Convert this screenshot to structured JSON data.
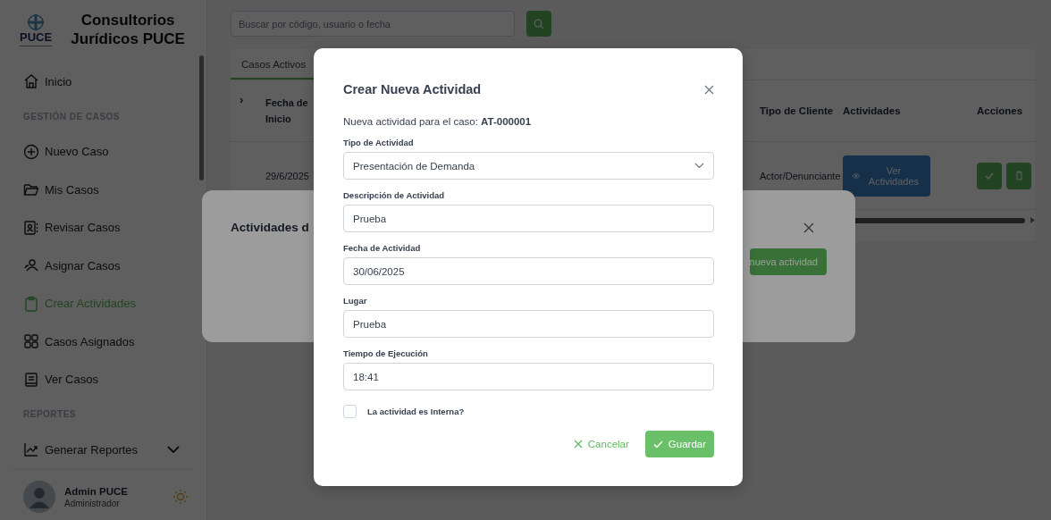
{
  "sidebar": {
    "brand": {
      "logo_text": "PUCE",
      "title": "Consultorios Jurídicos PUCE"
    },
    "items": [
      {
        "kind": "link",
        "label": "Inicio",
        "selected": false
      },
      {
        "kind": "section",
        "label": "GESTIÓN DE CASOS"
      },
      {
        "kind": "link",
        "label": "Nuevo Caso",
        "selected": false
      },
      {
        "kind": "link",
        "label": "Mis Casos",
        "selected": false
      },
      {
        "kind": "link",
        "label": "Revisar Casos",
        "selected": false
      },
      {
        "kind": "link",
        "label": "Asignar Casos",
        "selected": false
      },
      {
        "kind": "link",
        "label": "Crear Actividades",
        "selected": true
      },
      {
        "kind": "link",
        "label": "Casos Asignados",
        "selected": false
      },
      {
        "kind": "link",
        "label": "Ver Casos",
        "selected": false
      },
      {
        "kind": "section",
        "label": "REPORTES"
      },
      {
        "kind": "dropdown",
        "label": "Generar Reportes",
        "selected": false
      }
    ],
    "user": {
      "name": "Admin PUCE",
      "role": "Administrador"
    }
  },
  "main": {
    "search": {
      "placeholder": "Buscar por código, usuario o fecha"
    },
    "tabs": [
      {
        "label": "Casos Activos",
        "selected": true
      }
    ],
    "table": {
      "expand_caret": "›",
      "columns": [
        {
          "label": "Fecha de Inicio"
        },
        {
          "label": "Tipo de Cliente"
        },
        {
          "label": "Actividades"
        },
        {
          "label": "Acciones"
        }
      ],
      "rows": [
        {
          "fecha": "29/6/2025",
          "tipo_cliente": "Actor/Denunciante",
          "actividades_button": "Ver Actividades"
        }
      ]
    }
  },
  "activities_dialog": {
    "title": "Actividades d",
    "add_button": "nueva actividad"
  },
  "create_dialog": {
    "title": "Crear Nueva Actividad",
    "subtitle": "Nueva actividad para el caso: **AT-000001**",
    "fields": [
      {
        "kind": "select",
        "label": "Tipo de Actividad",
        "value": "Presentación de Demanda"
      },
      {
        "kind": "text",
        "label": "Descripción de Actividad",
        "value": "Prueba"
      },
      {
        "kind": "text",
        "label": "Fecha de Actividad",
        "value": "30/06/2025"
      },
      {
        "kind": "text",
        "label": "Lugar",
        "value": "Prueba"
      },
      {
        "kind": "text",
        "label": "Tiempo de Ejecución",
        "value": "18:41"
      }
    ],
    "checkbox": {
      "label": "La actividad es Interna?",
      "checked": false
    },
    "cancel_button": "Cancelar",
    "save_button": "Guardar"
  }
}
